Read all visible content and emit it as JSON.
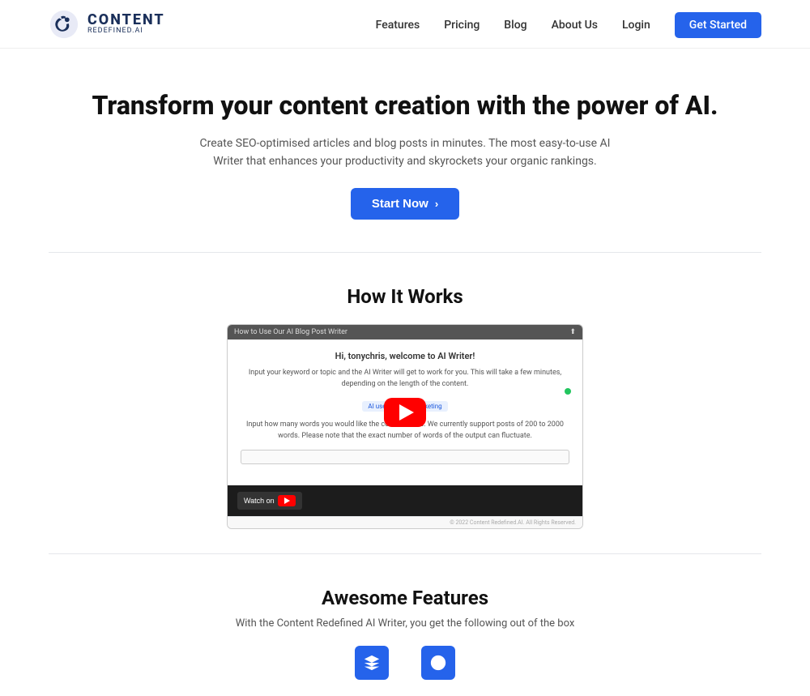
{
  "nav": {
    "brand": "CONTENT",
    "sub": "REDEFINED.AI",
    "links": [
      {
        "label": "Features",
        "id": "features"
      },
      {
        "label": "Pricing",
        "id": "pricing"
      },
      {
        "label": "Blog",
        "id": "blog"
      },
      {
        "label": "About Us",
        "id": "about"
      },
      {
        "label": "Login",
        "id": "login"
      },
      {
        "label": "Get Started",
        "id": "get-started"
      }
    ]
  },
  "hero": {
    "headline": "Transform your content creation with the power of AI.",
    "subtext": "Create SEO-optimised articles and blog posts in minutes. The most easy-to-use AI Writer that enhances your productivity and skyrockets your organic rankings.",
    "cta_label": "Start Now"
  },
  "how_it_works": {
    "heading": "How It Works",
    "video_title": "How to Use Our AI Blog Post Writer",
    "welcome_text": "Hi, tonychris, welcome to AI Writer!",
    "instruction1": "Input your keyword or topic and the AI Writer will get to work for you. This will take a few minutes, depending on the length of the content.",
    "tag": "AI use cases in marketing",
    "instruction2": "Input how many words you would like the content to be. We currently support posts of 200 to 2000 words. Please note that the exact number of words of the output can fluctuate.",
    "watch_on": "Watch on",
    "youtube": "YouTube",
    "copyright": "© 2022 Content Redefined.AI. All Rights Reserved."
  },
  "awesome_features": {
    "heading": "Awesome Features",
    "subtext": "With the Content Redefined AI Writer, you get the following out of the box"
  }
}
